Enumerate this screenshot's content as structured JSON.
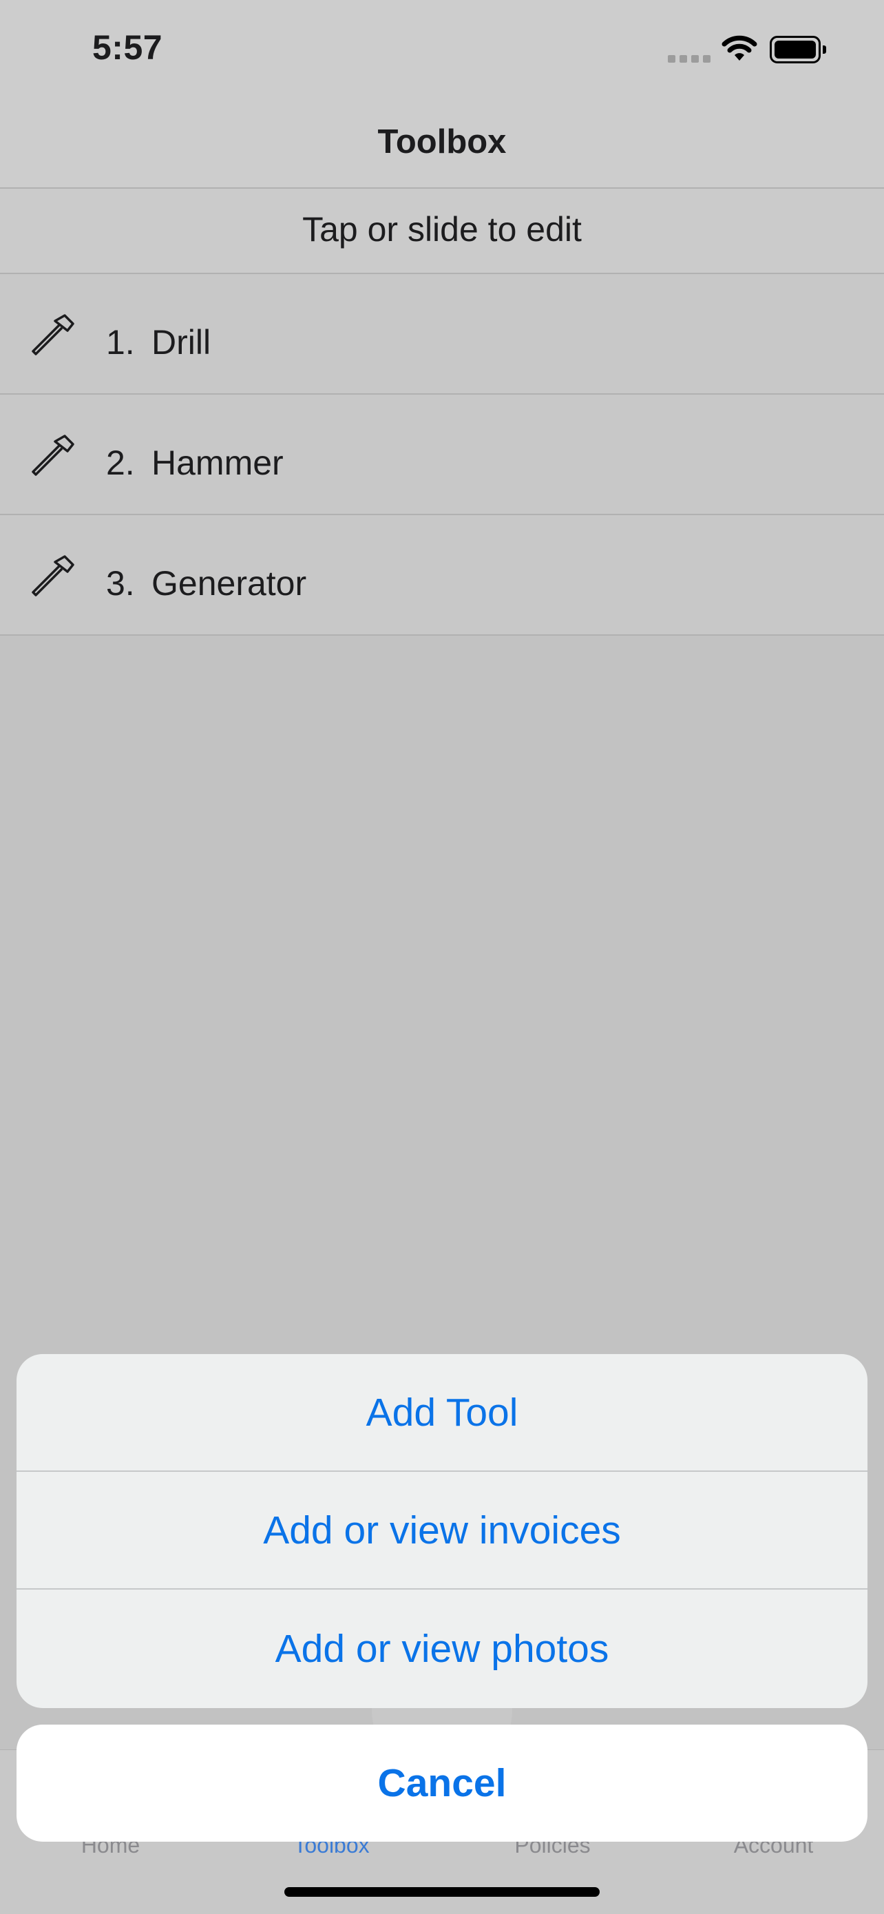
{
  "status_bar": {
    "time": "5:57"
  },
  "nav": {
    "title": "Toolbox"
  },
  "hint": {
    "text": "Tap or slide to edit"
  },
  "tools": [
    {
      "number": "1.",
      "name": "Drill",
      "icon": "hammer-icon"
    },
    {
      "number": "2.",
      "name": "Hammer",
      "icon": "hammer-icon"
    },
    {
      "number": "3.",
      "name": "Generator",
      "icon": "hammer-icon"
    }
  ],
  "action_sheet": {
    "items": [
      {
        "label": "Add Tool"
      },
      {
        "label": "Add or view invoices"
      },
      {
        "label": "Add or view photos"
      }
    ],
    "cancel_label": "Cancel"
  },
  "tab_bar": {
    "tabs": [
      {
        "label": "Home"
      },
      {
        "label": "Toolbox"
      },
      {
        "label": "Policies"
      },
      {
        "label": "Account"
      }
    ],
    "active_index": 1
  },
  "colors": {
    "accent": "#0a73e8",
    "overlay": "#c2c2c2",
    "sheet_background": "#eef0f0"
  }
}
